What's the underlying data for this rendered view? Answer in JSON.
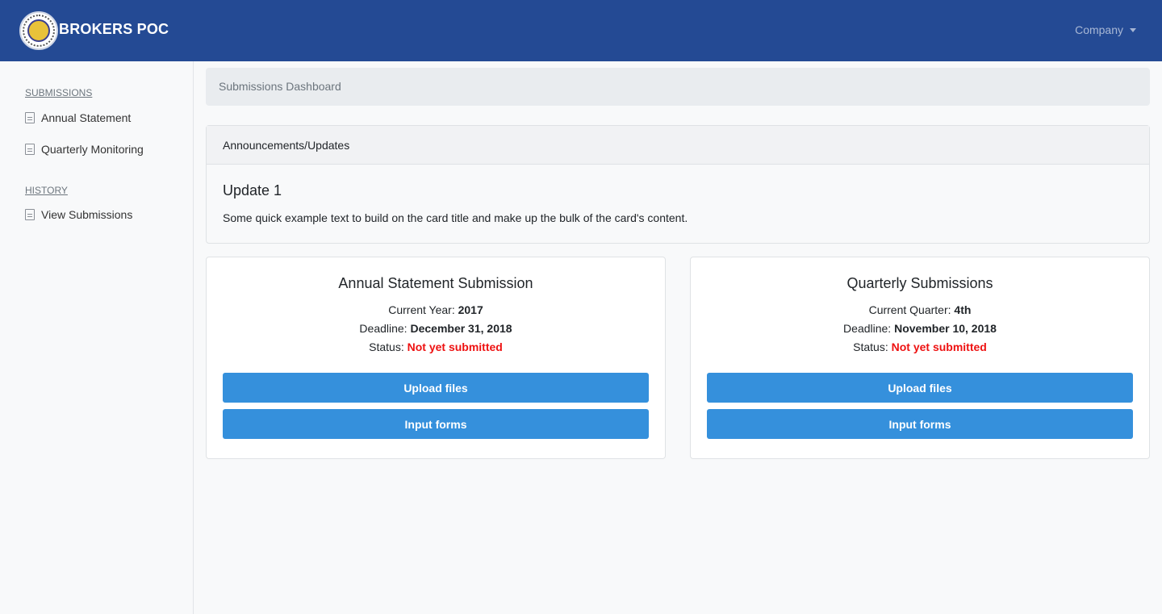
{
  "navbar": {
    "brand": "BROKERS POC",
    "company_label": "Company"
  },
  "sidebar": {
    "submissions_heading": "SUBMISSIONS",
    "items": [
      {
        "label": "Annual Statement",
        "icon": "document-icon"
      },
      {
        "label": "Quarterly Monitoring",
        "icon": "document-icon"
      }
    ],
    "history_heading": "HISTORY",
    "history_items": [
      {
        "label": "View Submissions",
        "icon": "document-icon"
      }
    ]
  },
  "breadcrumb": "Submissions Dashboard",
  "announcements": {
    "header": "Announcements/Updates",
    "title": "Update 1",
    "text": "Some quick example text to build on the card title and make up the bulk of the card's content."
  },
  "cards": [
    {
      "title": "Annual Statement Submission",
      "period_label": "Current Year: ",
      "period_value": "2017",
      "deadline_label": "Deadline: ",
      "deadline_value": "December 31, 2018",
      "status_label": "Status: ",
      "status_value": "Not yet submitted",
      "upload_label": "Upload files",
      "input_label": "Input forms"
    },
    {
      "title": "Quarterly Submissions",
      "period_label": "Current Quarter: ",
      "period_value": "4th",
      "deadline_label": "Deadline: ",
      "deadline_value": "November 10, 2018",
      "status_label": "Status: ",
      "status_value": "Not yet submitted",
      "upload_label": "Upload files",
      "input_label": "Input forms"
    }
  ],
  "colors": {
    "navbar": "#244a94",
    "button": "#3590dc",
    "status_alert": "#ee1111"
  }
}
